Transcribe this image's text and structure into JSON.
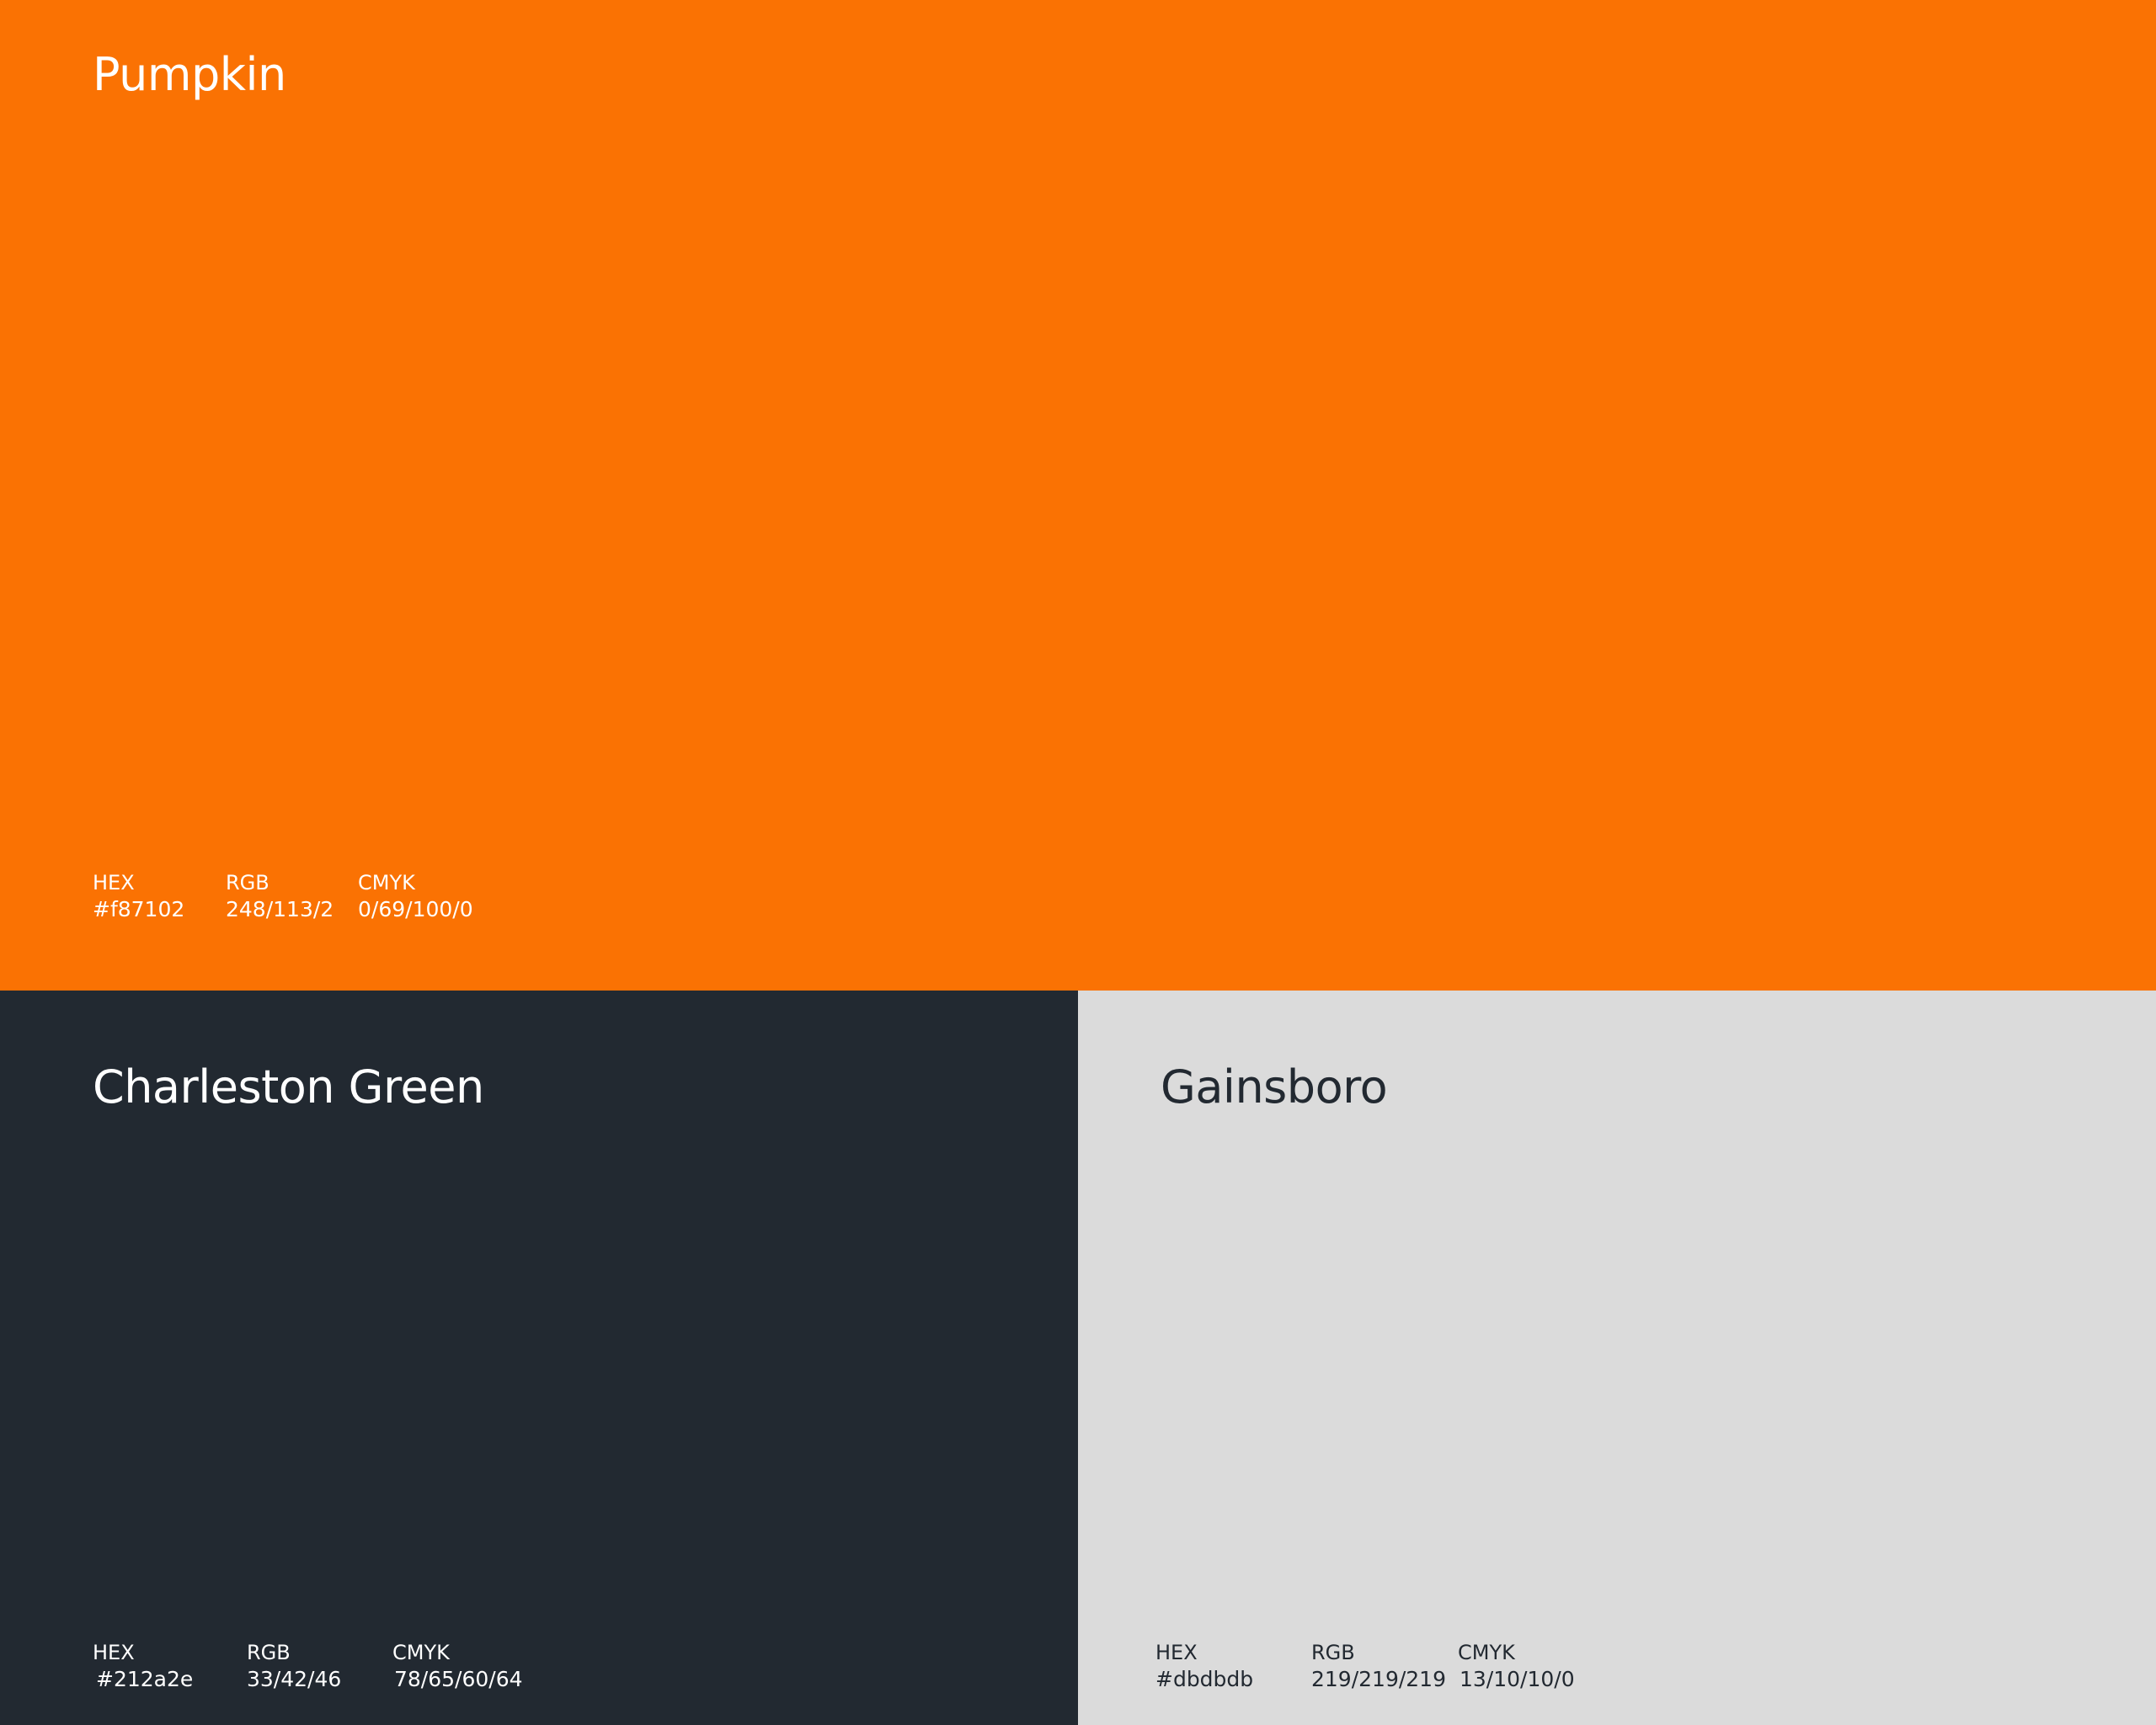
{
  "swatches": [
    {
      "name": "Pumpkin",
      "background": "#fa7203",
      "text_color": "#ffffff",
      "specs": [
        {
          "label": "HEX",
          "value": "#f87102"
        },
        {
          "label": "RGB",
          "value": "248/113/2"
        },
        {
          "label": "CMYK",
          "value": "0/69/100/0"
        }
      ]
    },
    {
      "name": "Charleston Green",
      "background": "#222931",
      "text_color": "#ffffff",
      "specs": [
        {
          "label": "HEX",
          "value": "#212a2e"
        },
        {
          "label": "RGB",
          "value": "33/42/46"
        },
        {
          "label": "CMYK",
          "value": "78/65/60/64"
        }
      ]
    },
    {
      "name": "Gainsboro",
      "background": "#dbdbdb",
      "text_color": "#222931",
      "specs": [
        {
          "label": "HEX",
          "value": "#dbdbdb"
        },
        {
          "label": "RGB",
          "value": "219/219/219"
        },
        {
          "label": "CMYK",
          "value": "13/10/10/0"
        }
      ]
    }
  ]
}
